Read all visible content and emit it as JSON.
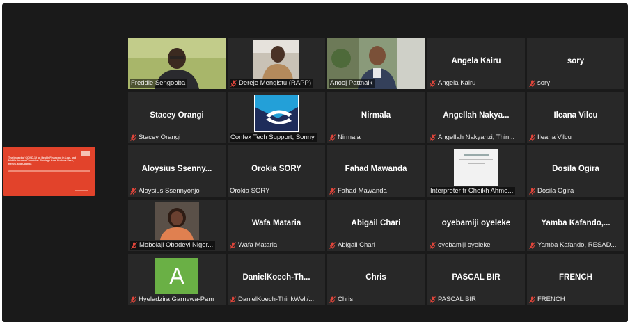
{
  "share": {
    "title": "The Impact of COVID-19 on Health Financing in Low- and Middle-Income Countries: Findings from Burkina Faso, Kenya, and Uganda"
  },
  "tiles": [
    {
      "name": "Freddie Sengooba",
      "center": "",
      "muted": false,
      "video": true,
      "active": false
    },
    {
      "name": "Dereje Mengistu (RAPP)",
      "center": "",
      "muted": true,
      "video": true,
      "active": false
    },
    {
      "name": "Anooj Pattnaik",
      "center": "",
      "muted": false,
      "video": true,
      "active": true
    },
    {
      "name": "Angela Kairu",
      "center": "Angela Kairu",
      "muted": true,
      "video": false,
      "active": false
    },
    {
      "name": "sory",
      "center": "sory",
      "muted": true,
      "video": false,
      "active": false
    },
    {
      "name": "Stacey Orangi",
      "center": "Stacey Orangi",
      "muted": true,
      "video": false,
      "active": false
    },
    {
      "name": "Confex Tech Support; Sonny",
      "center": "",
      "muted": false,
      "video": true,
      "active": false
    },
    {
      "name": "Nirmala",
      "center": "Nirmala",
      "muted": true,
      "video": false,
      "active": false
    },
    {
      "name": "Angellah Nakyanzi, Thin...",
      "center": "Angellah  Nakya...",
      "muted": true,
      "video": false,
      "active": false
    },
    {
      "name": "Ileana Vilcu",
      "center": "Ileana Vilcu",
      "muted": true,
      "video": false,
      "active": false
    },
    {
      "name": "Aloysius Ssennyonjo",
      "center": "Aloysius  Ssenny...",
      "muted": true,
      "video": false,
      "active": false
    },
    {
      "name": "Orokia SORY",
      "center": "Orokia SORY",
      "muted": false,
      "video": false,
      "active": false
    },
    {
      "name": "Fahad Mawanda",
      "center": "Fahad Mawanda",
      "muted": true,
      "video": false,
      "active": false
    },
    {
      "name": "Interpreter fr Cheikh Ahme...",
      "center": "",
      "muted": false,
      "video": true,
      "active": false
    },
    {
      "name": "Dosila Ogira",
      "center": "Dosila Ogira",
      "muted": true,
      "video": false,
      "active": false
    },
    {
      "name": "Mobolaji Obadeyi Niger...",
      "center": "",
      "muted": true,
      "video": true,
      "active": false
    },
    {
      "name": "Wafa Mataria",
      "center": "Wafa Mataria",
      "muted": true,
      "video": false,
      "active": false
    },
    {
      "name": "Abigail Chari",
      "center": "Abigail Chari",
      "muted": true,
      "video": false,
      "active": false
    },
    {
      "name": "oyebamiji oyeleke",
      "center": "oyebamiji oyeleke",
      "muted": true,
      "video": false,
      "active": false
    },
    {
      "name": "Yamba Kafando, RESAD...",
      "center": "Yamba  Kafando,...",
      "muted": true,
      "video": false,
      "active": false
    },
    {
      "name": "Hyeladzira Garnvwa-Pam",
      "center": "",
      "muted": true,
      "video": false,
      "active": false,
      "avatar_letter": "A"
    },
    {
      "name": "DanielKoech-ThinkWell/...",
      "center": "DanielKoech-Th...",
      "muted": true,
      "video": false,
      "active": false
    },
    {
      "name": "Chris",
      "center": "Chris",
      "muted": true,
      "video": false,
      "active": false
    },
    {
      "name": "PASCAL BIR",
      "center": "PASCAL BIR",
      "muted": true,
      "video": false,
      "active": false
    },
    {
      "name": "FRENCH",
      "center": "FRENCH",
      "muted": true,
      "video": false,
      "active": false
    }
  ],
  "colors": {
    "background": "#1a1a1a",
    "tile": "#282828",
    "active_border": "#b6e05a",
    "muted_icon": "#e0453a",
    "avatar": "#6ab045",
    "share_slide": "#e2432b"
  }
}
